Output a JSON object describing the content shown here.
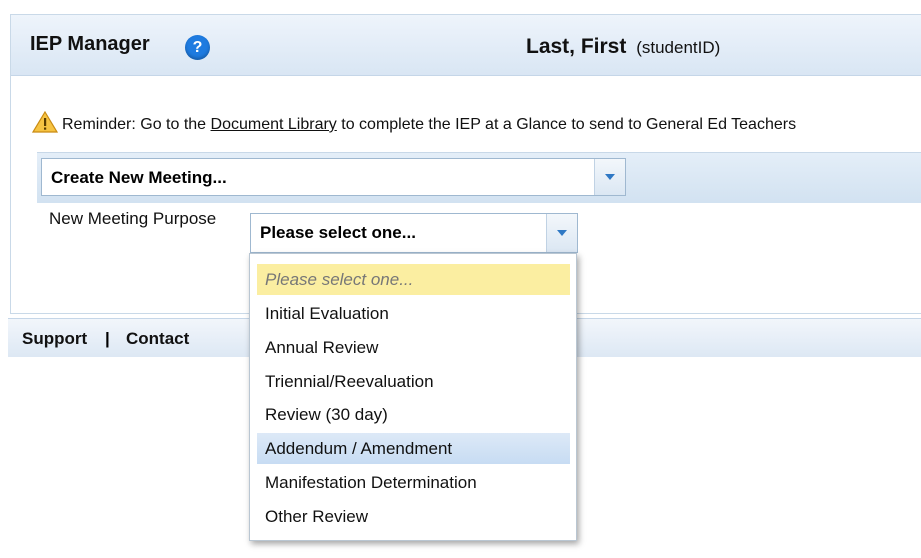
{
  "header": {
    "app_title": "IEP Manager",
    "help_icon_glyph": "?",
    "student_name": "Last, First",
    "student_id": "(studentID)"
  },
  "reminder": {
    "prefix": "Reminder: Go to the",
    "link": "Document Library",
    "suffix": "to complete the IEP at a Glance to send to General Ed Teachers"
  },
  "create_meeting": {
    "value": "Create New Meeting..."
  },
  "meeting_purpose": {
    "label": "New Meeting Purpose",
    "value": "Please select one...",
    "options": [
      "Please select one...",
      "Initial Evaluation",
      "Annual Review",
      "Triennial/Reevaluation",
      "Review (30 day)",
      "Addendum / Amendment",
      "Manifestation Determination",
      "Other Review"
    ],
    "highlighted_option": "Please select one...",
    "hovered_option": "Addendum / Amendment"
  },
  "footer": {
    "support": "Support",
    "separator": "|",
    "contact": "Contact"
  },
  "colors": {
    "accent": "#1e7be0",
    "highlight": "#fbeea1",
    "hover": "#c7dcf3"
  }
}
